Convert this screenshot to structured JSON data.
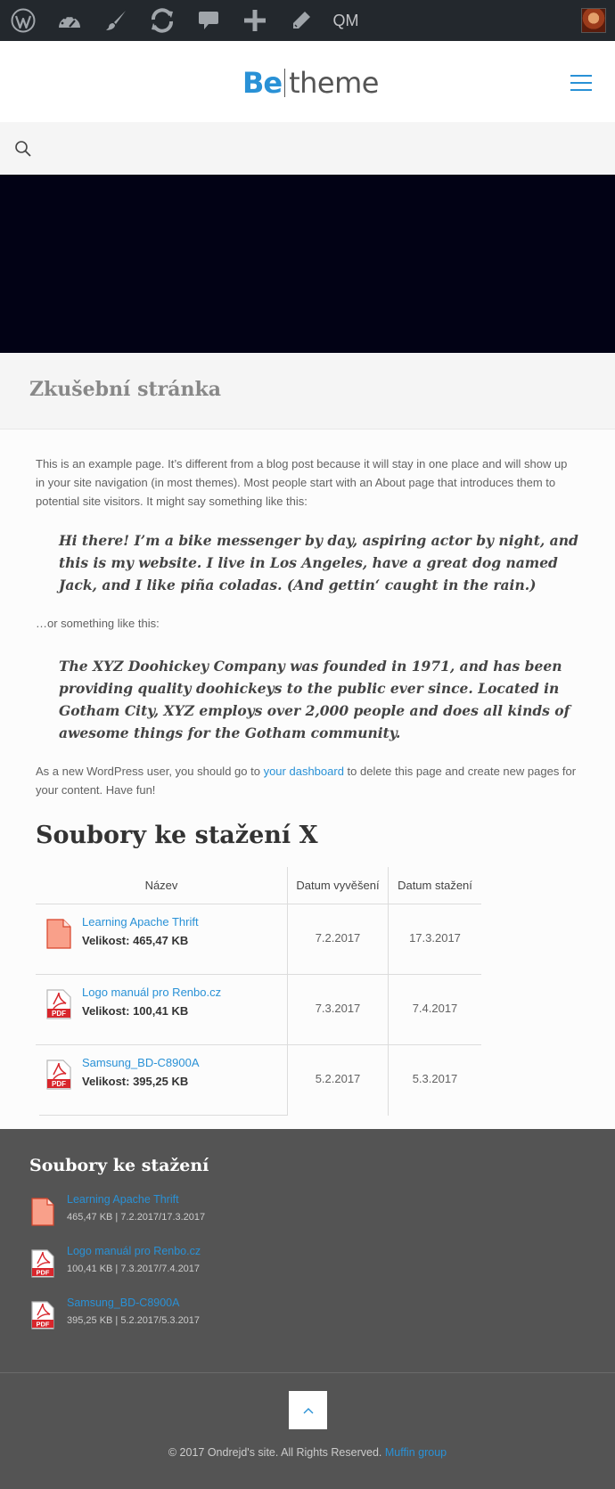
{
  "adminbar": {
    "icons": [
      "wordpress-icon",
      "dashboard-icon",
      "customize-icon",
      "updates-icon",
      "comments-icon",
      "new-icon",
      "edit-icon"
    ],
    "qm_label": "QM",
    "avatar": "avatar"
  },
  "header": {
    "logo_be": "Be",
    "logo_theme": "theme",
    "accent": "#2991d6"
  },
  "page": {
    "title": "Zkušební stránka",
    "intro": "This is an example page. It’s different from a blog post because it will stay in one place and will show up in your site navigation (in most themes). Most people start with an About page that introduces them to potential site visitors. It might say something like this:",
    "quote1": "Hi there! I’m a bike messenger by day, aspiring actor by night, and this is my website. I live in Los Angeles, have a great dog named Jack, and I like piña coladas. (And gettin‘ caught in the rain.)",
    "or_text": "…or something like this:",
    "quote2": "The XYZ Doohickey Company was founded in 1971, and has been providing quality doohickeys to the public ever since. Located in Gotham City, XYZ employs over 2,000 people and does all kinds of awesome things for the Gotham community.",
    "outro_before": "As a new WordPress user, you should go to ",
    "outro_link": "your dashboard",
    "outro_after": " to delete this page and create new pages for your content. Have fun!"
  },
  "downloads": {
    "heading": "Soubory ke stažení X",
    "columns": [
      "Název",
      "Datum vyvěšení",
      "Datum stažení"
    ],
    "rows": [
      {
        "name": "Learning Apache Thrift",
        "size": "Velikost: 465,47 KB",
        "posted": "7.2.2017",
        "expires": "17.3.2017",
        "icon": "file-icon"
      },
      {
        "name": "Logo manuál pro Renbo.cz",
        "size": "Velikost: 100,41 KB",
        "posted": "7.3.2017",
        "expires": "7.4.2017",
        "icon": "pdf-icon"
      },
      {
        "name": "Samsung_BD-C8900A",
        "size": "Velikost: 395,25 KB",
        "posted": "5.2.2017",
        "expires": "5.3.2017",
        "icon": "pdf-icon"
      }
    ]
  },
  "widget": {
    "heading": "Soubory ke stažení",
    "items": [
      {
        "name": "Learning Apache Thrift",
        "meta": "465,47 KB | 7.2.2017/17.3.2017",
        "icon": "file-icon"
      },
      {
        "name": "Logo manuál pro Renbo.cz",
        "meta": "100,41 KB | 7.3.2017/7.4.2017",
        "icon": "pdf-icon"
      },
      {
        "name": "Samsung_BD-C8900A",
        "meta": "395,25 KB | 5.2.2017/5.3.2017",
        "icon": "pdf-icon"
      }
    ]
  },
  "footer": {
    "copyright": "© 2017 Ondrejd's site. All Rights Reserved. ",
    "credit_link": "Muffin group",
    "pdf_label": "PDF"
  }
}
